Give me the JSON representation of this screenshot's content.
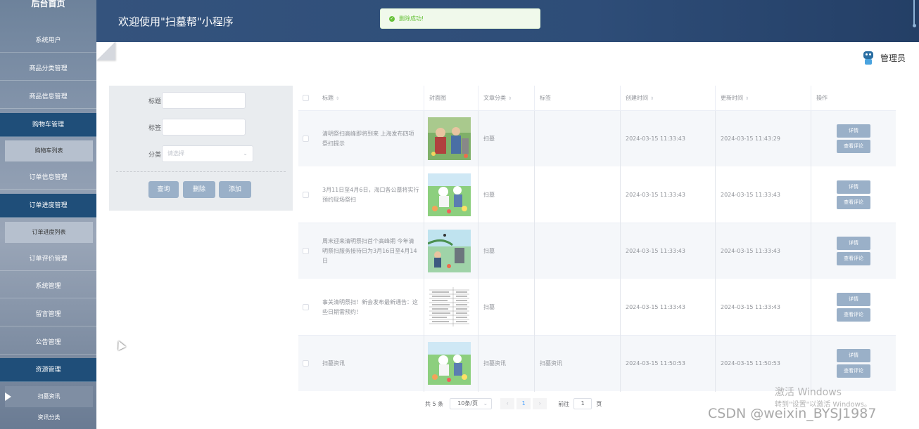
{
  "sidebar": {
    "title": "后台首页",
    "items": [
      {
        "label": "系统用户"
      },
      {
        "label": "商品分类管理"
      },
      {
        "label": "商品信息管理"
      },
      {
        "label": "购物车管理"
      },
      {
        "label": "购物车列表"
      },
      {
        "label": "订单信息管理"
      },
      {
        "label": "订单进度管理"
      },
      {
        "label": "订单进度列表"
      },
      {
        "label": "订单评价管理"
      },
      {
        "label": "系统管理"
      },
      {
        "label": "留言管理"
      },
      {
        "label": "公告管理"
      },
      {
        "label": "资源管理"
      },
      {
        "label": "扫墓资讯"
      },
      {
        "label": "资讯分类"
      }
    ]
  },
  "header": {
    "title": "欢迎使用\"扫墓帮\"小程序",
    "user": "管理员"
  },
  "toast": {
    "message": "删除成功!"
  },
  "search": {
    "title_label": "标题",
    "tag_label": "标签",
    "category_label": "分类",
    "category_placeholder": "请选择",
    "query_button": "查询",
    "delete_button": "删除",
    "add_button": "添加"
  },
  "table": {
    "headers": [
      "标题",
      "封面图",
      "文章分类",
      "标签",
      "创建时间",
      "更新时间",
      "操作"
    ],
    "rows": [
      {
        "title": "清明祭扫高峰即将到来 上海发布四项祭扫提示",
        "category": "扫墓",
        "tag": "",
        "created": "2024-03-15 11:33:43",
        "updated": "2024-03-15 11:43:29"
      },
      {
        "title": "3月11日至4月6日，海口各公墓将实行预约现场祭扫",
        "category": "扫墓",
        "tag": "",
        "created": "2024-03-15 11:33:43",
        "updated": "2024-03-15 11:33:43"
      },
      {
        "title": "周末迎来清明祭扫首个高峰期 今年清明祭扫服务接待日为3月16日至4月14日",
        "category": "扫墓",
        "tag": "",
        "created": "2024-03-15 11:33:43",
        "updated": "2024-03-15 11:33:43"
      },
      {
        "title": "事关清明祭扫！新会发布最新通告：这些日期需预约！",
        "category": "扫墓",
        "tag": "",
        "created": "2024-03-15 11:33:43",
        "updated": "2024-03-15 11:33:43"
      },
      {
        "title": "扫墓资讯",
        "category": "扫墓资讯",
        "tag": "扫墓资讯",
        "created": "2024-03-15 11:50:53",
        "updated": "2024-03-15 11:50:53"
      }
    ],
    "detail_button": "详情",
    "comment_button": "查看评论"
  },
  "pagination": {
    "total": "共 5 条",
    "page_size": "10条/页",
    "current_page": "1",
    "goto_label": "前往",
    "goto_value": "1",
    "page_unit": "页"
  },
  "watermarks": {
    "activate": "激活 Windows",
    "activate_sub": "转到\"设置\"以激活 Windows。",
    "csdn": "CSDN @weixin_BYSJ1987"
  },
  "colors": {
    "sidebar_dark": "#1f4e79",
    "header": "#2e4d78",
    "button": "#9ab0c8",
    "success": "#67c23a"
  }
}
